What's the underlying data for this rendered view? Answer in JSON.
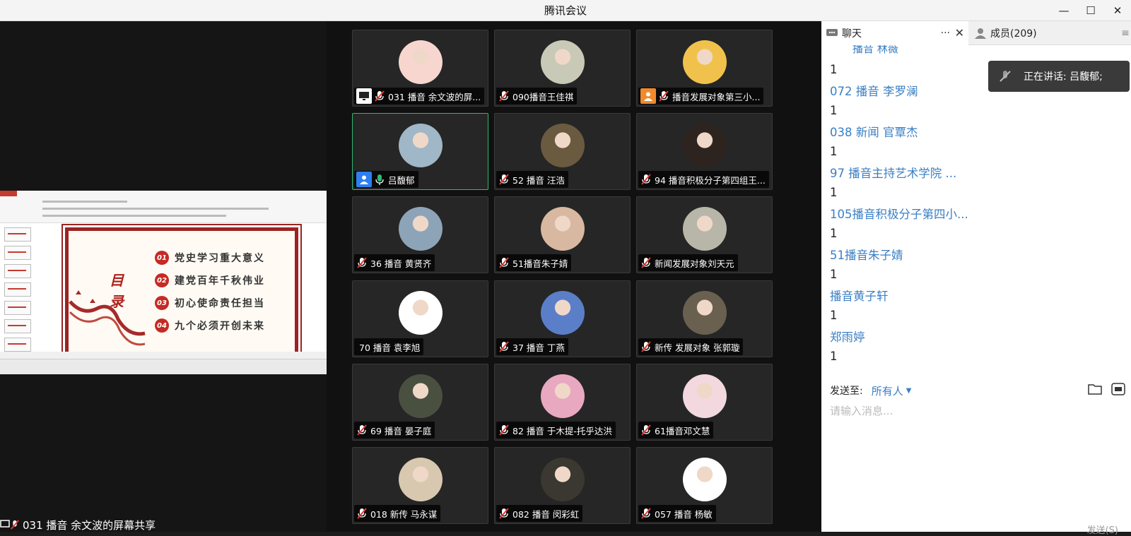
{
  "window": {
    "title": "腾讯会议",
    "controls": [
      "—",
      "☐",
      "✕"
    ]
  },
  "share": {
    "slide_title": "目录",
    "items": [
      {
        "num": "01",
        "text": "党史学习重大意义"
      },
      {
        "num": "02",
        "text": "建党百年千秋伟业"
      },
      {
        "num": "03",
        "text": "初心使命责任担当"
      },
      {
        "num": "04",
        "text": "九个必须开创未来"
      }
    ],
    "sharer_name": "031 播音 余文波的屏幕共享"
  },
  "participants": [
    {
      "name": "031 播音 余文波的屏...",
      "badge": "screen",
      "mic": "muted",
      "avatar_color": "#f6d6cf"
    },
    {
      "name": "090播音王佳祺",
      "badge": null,
      "mic": "muted",
      "avatar_color": "#c9c9b8"
    },
    {
      "name": "播音发展对象第三小...",
      "badge": "orange-user",
      "mic": "muted",
      "avatar_color": "#f1c24b"
    },
    {
      "name": "吕馥郁",
      "badge": "blue-user",
      "mic": "active",
      "avatar_color": "#9fb7c7",
      "speaking": true
    },
    {
      "name": "52 播音 汪浩",
      "badge": null,
      "mic": "muted",
      "avatar_color": "#6a5a40"
    },
    {
      "name": "94 播音积极分子第四组王...",
      "badge": null,
      "mic": "muted",
      "avatar_color": "#2d2420"
    },
    {
      "name": "36 播音 黄贤齐",
      "badge": null,
      "mic": "muted",
      "avatar_color": "#8da4b8"
    },
    {
      "name": "51播音朱子婧",
      "badge": null,
      "mic": "muted",
      "avatar_color": "#d8b8a0"
    },
    {
      "name": "新闻发展对象刘天元",
      "badge": null,
      "mic": "muted",
      "avatar_color": "#b8b6a8"
    },
    {
      "name": "70 播音 袁李旭",
      "badge": null,
      "mic": "none",
      "avatar_color": "#ffffff"
    },
    {
      "name": "37 播音 丁燕",
      "badge": null,
      "mic": "muted",
      "avatar_color": "#5a7fc8"
    },
    {
      "name": "新传 发展对象 张郭璇",
      "badge": null,
      "mic": "muted",
      "avatar_color": "#6a6050"
    },
    {
      "name": "69 播音 晏子庭",
      "badge": null,
      "mic": "muted",
      "avatar_color": "#4a5040"
    },
    {
      "name": "82 播音 于木提-托乎达洪",
      "badge": null,
      "mic": "muted",
      "avatar_color": "#e8a8c0"
    },
    {
      "name": "61播音邓文慧",
      "badge": null,
      "mic": "muted",
      "avatar_color": "#f3d8e0"
    },
    {
      "name": "018 新传 马永谋",
      "badge": null,
      "mic": "muted",
      "avatar_color": "#d8c8b0"
    },
    {
      "name": "082 播音 闵彩虹",
      "badge": null,
      "mic": "muted",
      "avatar_color": "#3a3830"
    },
    {
      "name": "057 播音 杨敏",
      "badge": null,
      "mic": "muted",
      "avatar_color": "#ffffff"
    }
  ],
  "sidebar": {
    "chat_tab": "聊天",
    "more": "···",
    "close": "✕",
    "members_tab": "成员(209)",
    "partial_top": "播音 林薇",
    "messages": [
      {
        "type": "text",
        "value": "1"
      },
      {
        "type": "sender",
        "value": "072 播音 李罗澜"
      },
      {
        "type": "text",
        "value": "1"
      },
      {
        "type": "sender",
        "value": "038 新闻 官覃杰"
      },
      {
        "type": "text",
        "value": "1"
      },
      {
        "type": "sender",
        "value": "97 播音主持艺术学院 ..."
      },
      {
        "type": "text",
        "value": "1"
      },
      {
        "type": "sender",
        "value": "105播音积极分子第四小..."
      },
      {
        "type": "text",
        "value": "1"
      },
      {
        "type": "sender",
        "value": "51播音朱子婧"
      },
      {
        "type": "text",
        "value": "1"
      },
      {
        "type": "sender",
        "value": "播音黄子轩"
      },
      {
        "type": "text",
        "value": "1"
      },
      {
        "type": "sender",
        "value": "郑雨婷"
      },
      {
        "type": "text",
        "value": "1"
      }
    ],
    "speaking_text": "正在讲话: 吕馥郁;",
    "send_to_label": "发送至:",
    "send_to_target": "所有人",
    "input_placeholder": "请输入消息...",
    "send_button": "发送(S)"
  }
}
